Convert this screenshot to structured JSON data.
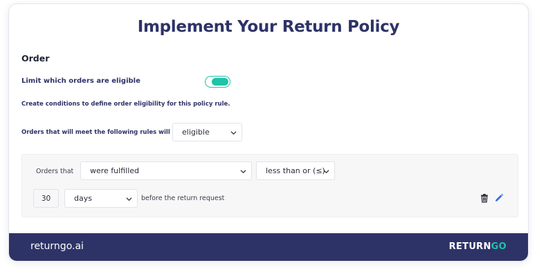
{
  "page": {
    "title": "Implement Your Return Policy"
  },
  "section": {
    "title": "Order"
  },
  "limit": {
    "label": "Limit which orders are eligible",
    "enabled": true
  },
  "help_text": "Create conditions to define order eligibility for this policy rule.",
  "eligibility": {
    "label": "Orders that will meet the following rules will be",
    "value": "eligible"
  },
  "rule": {
    "prefix": "Orders that",
    "field": "were fulfilled",
    "operator": "less than or (≤)",
    "amount": "30",
    "unit": "days",
    "suffix": "before the return request"
  },
  "icons": {
    "delete": "trash-icon",
    "edit": "pencil-icon",
    "dropdown": "chevron-down-icon"
  },
  "colors": {
    "brand": "#2e3367",
    "accent": "#1fc3a7",
    "edit": "#3b6fd8"
  },
  "footer": {
    "site": "returngo.ai",
    "logo_part1": "RETURN",
    "logo_part2": "GO"
  }
}
